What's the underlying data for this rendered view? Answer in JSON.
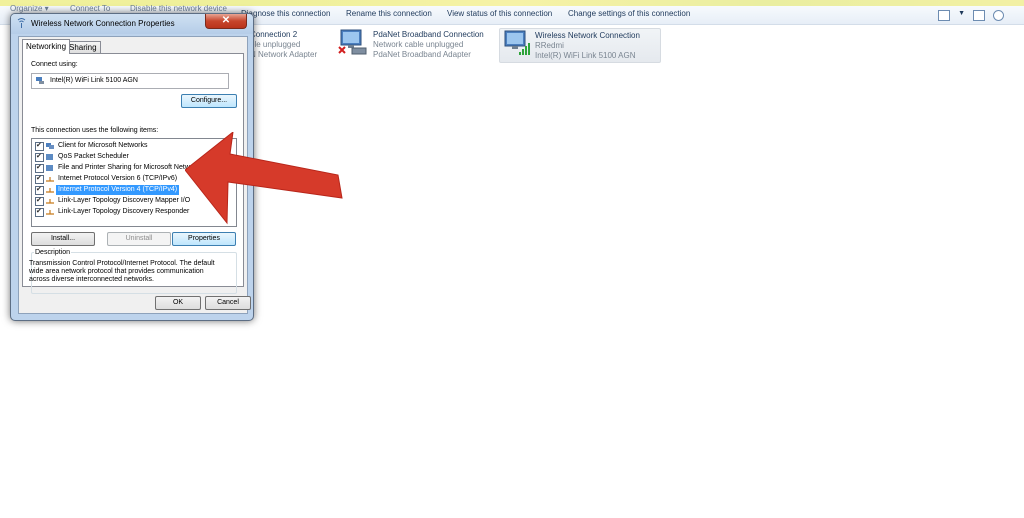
{
  "explorer": {
    "toolbar": [
      "Organize ▾",
      "Connect To",
      "Disable this network device",
      "Diagnose this connection",
      "Rename this connection",
      "View status of this connection",
      "Change settings of this connection"
    ],
    "connections": [
      {
        "name": "Connection 2",
        "status": "ble unplugged",
        "adapter": "N Network Adapter"
      },
      {
        "name": "PdaNet Broadband Connection",
        "status": "Network cable unplugged",
        "adapter": "PdaNet Broadband Adapter"
      },
      {
        "name": "Wireless Network Connection",
        "status": "RRedmi",
        "adapter": "Intel(R) WiFi Link 5100 AGN"
      }
    ]
  },
  "dialog": {
    "title": "Wireless Network Connection Properties",
    "close": "✕",
    "tabs": [
      "Networking",
      "Sharing"
    ],
    "connect_using_label": "Connect using:",
    "adapter": "Intel(R) WiFi Link 5100 AGN",
    "configure_label": "Configure...",
    "items_label": "This connection uses the following items:",
    "items": [
      "Client for Microsoft Networks",
      "QoS Packet Scheduler",
      "File and Printer Sharing for Microsoft Networks",
      "Internet Protocol Version 6 (TCP/IPv6)",
      "Internet Protocol Version 4 (TCP/IPv4)",
      "Link-Layer Topology Discovery Mapper I/O",
      "Link-Layer Topology Discovery Responder"
    ],
    "selected_item": "Internet Protocol Version 4 (TCP/IPv4)",
    "install_label": "Install...",
    "uninstall_label": "Uninstall",
    "properties_label": "Properties",
    "description_label": "Description",
    "description_text": "Transmission Control Protocol/Internet Protocol. The default wide area network protocol that provides communication across diverse interconnected networks.",
    "ok_label": "OK",
    "cancel_label": "Cancel"
  },
  "colors": {
    "highlight": "#3399ff",
    "arrow": "#d63a2a"
  }
}
